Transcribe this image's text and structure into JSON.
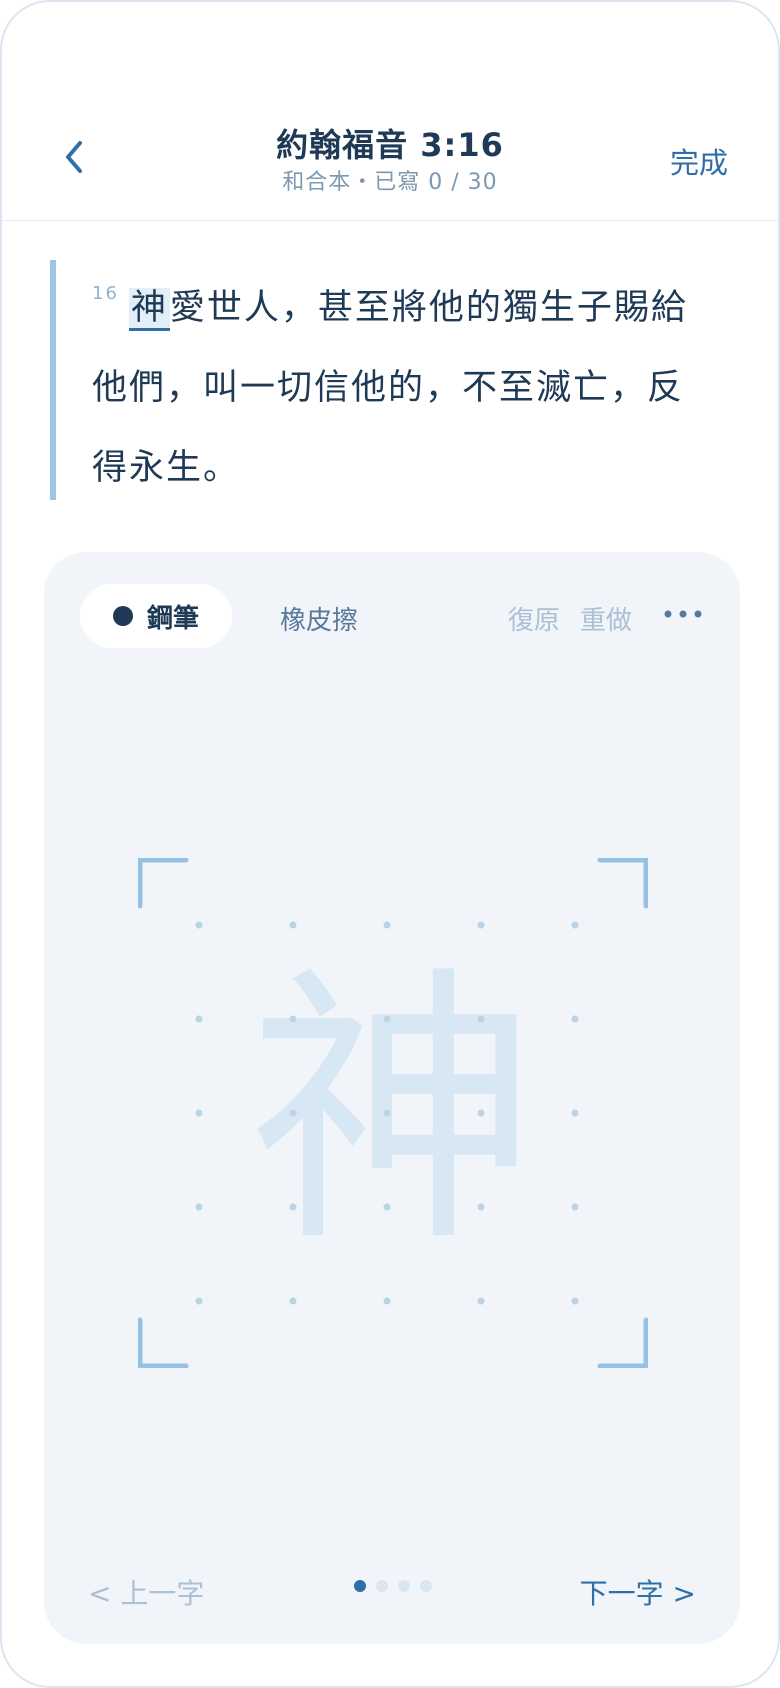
{
  "header": {
    "back_label": "",
    "title": "約翰福音 3:16",
    "subtitle": "和合本・已寫 0 / 30",
    "done_label": "完成"
  },
  "verse": {
    "number": "16",
    "highlighted_char": "神",
    "rest_text": "愛世人，甚至將他的獨生子賜給他們，叫一切信他的，不至滅亡，反得永生。"
  },
  "toolbar": {
    "pen_label": "鋼筆",
    "eraser_label": "橡皮擦",
    "undo_label": "復原",
    "redo_label": "重做",
    "more_icon": "more-dots-icon"
  },
  "canvas": {
    "ghost_char": "神",
    "grid": "dot-grid-5x5"
  },
  "footer": {
    "prev_label": "< 上一字",
    "next_label": "下一字 >",
    "page_count": 4,
    "current_page": 1
  },
  "colors": {
    "accent": "#2f6fa8",
    "text": "#1f3a56",
    "panel_bg": "#f1f5f9",
    "ghost": "#d8e7f4",
    "bracket": "#93c2e6"
  }
}
